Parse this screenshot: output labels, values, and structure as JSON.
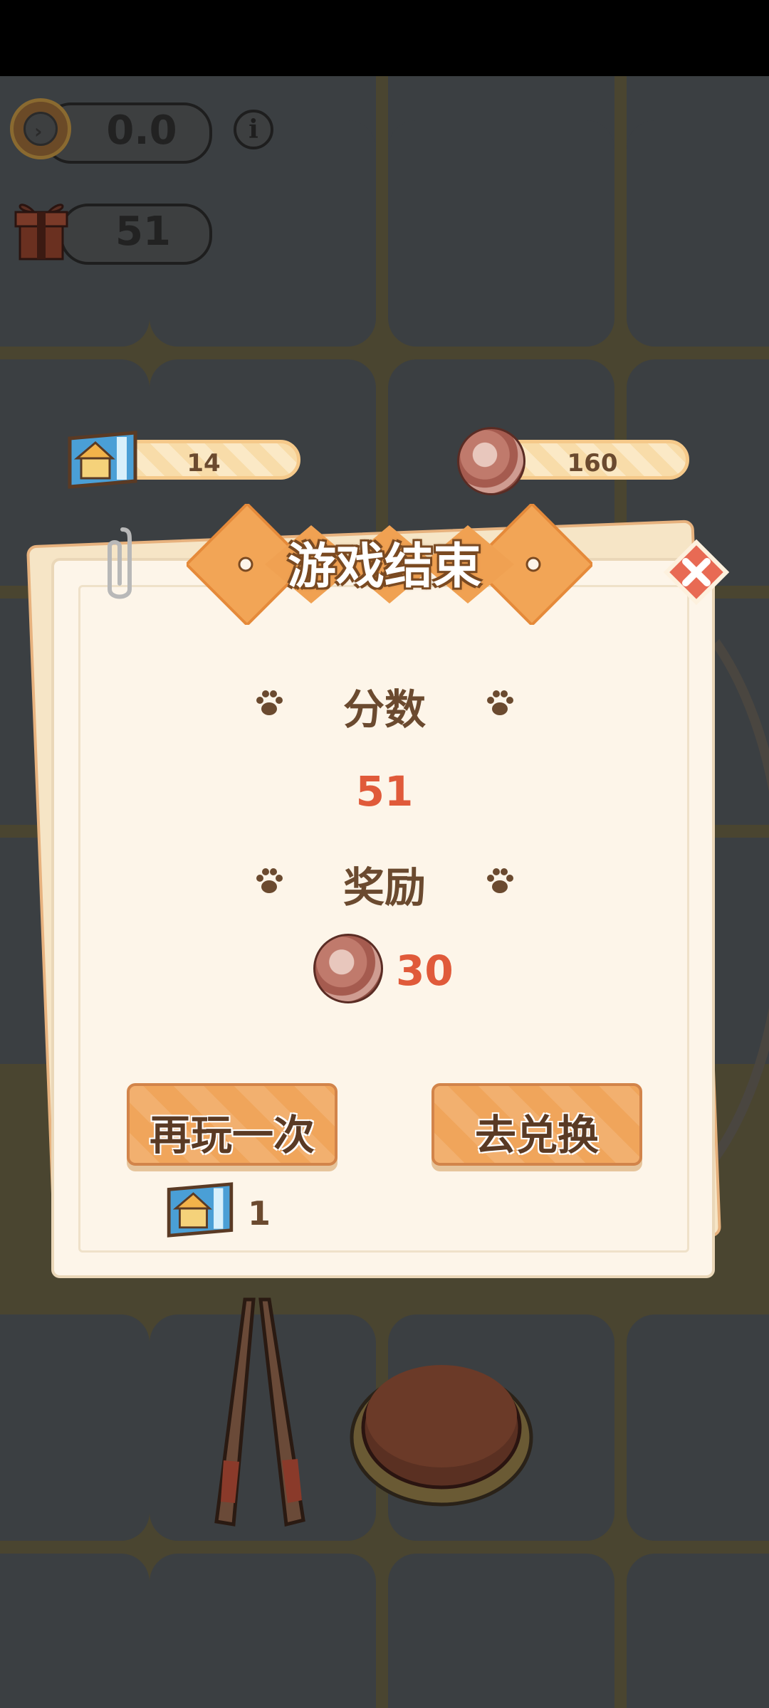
{
  "hud": {
    "timer_value": "0.0",
    "gift_count": "51"
  },
  "resources": {
    "tickets": "14",
    "coins": "160"
  },
  "dialog": {
    "title": "游戏结束",
    "score_label": "分数",
    "score_value": "51",
    "reward_label": "奖励",
    "reward_value": "30",
    "play_again_label": "再玩一次",
    "exchange_label": "去兑换",
    "ticket_reward": "1"
  },
  "icons": {
    "timer": "clock-icon",
    "info": "info-icon",
    "gift": "gift-icon",
    "ticket": "ticket-icon",
    "coin": "coin-icon",
    "paw": "paw-icon",
    "close": "close-icon"
  },
  "colors": {
    "accent_orange": "#f0a55b",
    "value_red": "#e05a3a",
    "text_brown": "#6b4a2f",
    "board": "#3b3f42"
  }
}
